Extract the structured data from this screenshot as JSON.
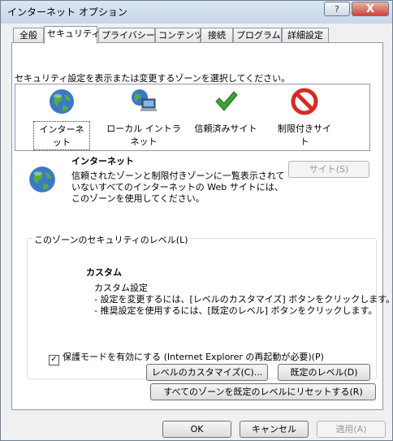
{
  "window": {
    "title": "インターネット オプション",
    "help": "?",
    "close": "X"
  },
  "tabs": [
    {
      "label": "全般"
    },
    {
      "label": "セキュリティ"
    },
    {
      "label": "プライバシー"
    },
    {
      "label": "コンテンツ"
    },
    {
      "label": "接続"
    },
    {
      "label": "プログラム"
    },
    {
      "label": "詳細設定"
    }
  ],
  "security": {
    "instruction": "セキュリティ設定を表示または変更するゾーンを選択してください。",
    "zones": [
      {
        "label": "インターネット",
        "icon": "globe-icon"
      },
      {
        "label": "ローカル イントラネット",
        "icon": "intranet-icon"
      },
      {
        "label": "信頼済みサイト",
        "icon": "checkmark-icon"
      },
      {
        "label": "制限付きサイト",
        "icon": "restricted-icon"
      }
    ],
    "selected_zone": {
      "title": "インターネット",
      "description": "信頼されたゾーンと制限付きゾーンに一覧表示されていないすべてのインターネットの Web サイトには、このゾーンを使用してください。"
    },
    "sites_button": "サイト(S)",
    "level_group": {
      "legend": "このゾーンのセキュリティのレベル(L)",
      "level_name": "カスタム",
      "desc_lines": [
        "カスタム設定",
        "- 設定を変更するには、[レベルのカスタマイズ] ボタンをクリックします。",
        "- 推奨設定を使用するには、[既定のレベル] ボタンをクリックします。"
      ],
      "protected_mode": "保護モードを有効にする (Internet Explorer の再起動が必要)(P)",
      "protected_mode_checked": true,
      "custom_level_button": "レベルのカスタマイズ(C)...",
      "default_level_button": "既定のレベル(D)"
    },
    "reset_all_button": "すべてのゾーンを既定のレベルにリセットする(R)"
  },
  "footer": {
    "ok": "OK",
    "cancel": "キャンセル",
    "apply": "適用(A)"
  },
  "colors": {
    "accent": "#3c78c8",
    "restricted": "#d62b24",
    "trusted": "#3aa33a"
  }
}
